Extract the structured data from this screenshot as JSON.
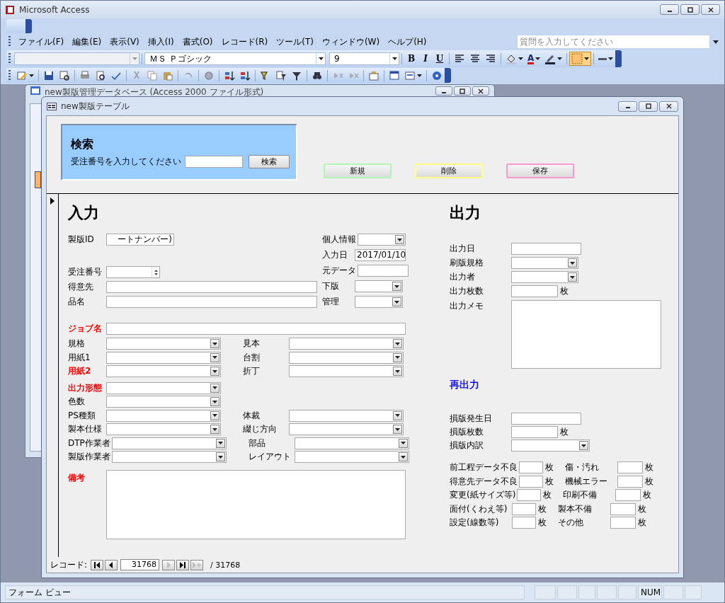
{
  "app_window": {
    "title": "Microsoft Access"
  },
  "menu": [
    "ファイル(F)",
    "編集(E)",
    "表示(V)",
    "挿入(I)",
    "書式(O)",
    "レコード(R)",
    "ツール(T)",
    "ウィンドウ(W)",
    "ヘルプ(H)"
  ],
  "help_search": {
    "placeholder": "質問を入力してください"
  },
  "format_toolbar": {
    "font": "ＭＳ Ｐゴシック",
    "size": "9",
    "style_buttons": [
      "B",
      "I",
      "U"
    ],
    "font_color_glyph": "A"
  },
  "background_window": {
    "title": "new製版管理データベース (Access 2000 ファイル形式)"
  },
  "form_window": {
    "title": "new製版テーブル"
  },
  "search_panel": {
    "title": "検索",
    "prompt": "受注番号を入力してください",
    "button": "検索"
  },
  "action_buttons": [
    {
      "label": "新規",
      "color": "#b3f5b3"
    },
    {
      "label": "削除",
      "color": "#ffff80"
    },
    {
      "label": "保存",
      "color": "#ff99cc"
    }
  ],
  "input_section": {
    "title": "入力",
    "top_left": [
      {
        "label": "製版ID",
        "kind": "text",
        "value": "ートナンバー)"
      },
      {
        "label": "受注番号",
        "kind": "spin"
      },
      {
        "label": "得意先",
        "kind": "text"
      },
      {
        "label": "品名",
        "kind": "text"
      }
    ],
    "top_right": [
      {
        "label": "個人情報",
        "kind": "combo"
      },
      {
        "label": "入力日",
        "kind": "text",
        "value": "2017/01/10"
      },
      {
        "label": "元データ",
        "kind": "text"
      },
      {
        "label": "下版",
        "kind": "combo"
      },
      {
        "label": "管理",
        "kind": "combo"
      }
    ],
    "job": {
      "label": "ジョブ名",
      "emphasized": true
    },
    "combo_rows": [
      {
        "left": {
          "label": "規格",
          "emphasized": false
        },
        "right": {
          "label": "見本",
          "emphasized": false
        }
      },
      {
        "left": {
          "label": "用紙1",
          "emphasized": false
        },
        "right": {
          "label": "台割",
          "emphasized": false
        }
      },
      {
        "left": {
          "label": "用紙2",
          "emphasized": true
        },
        "right": {
          "label": "折丁",
          "emphasized": false
        }
      },
      {
        "left": {
          "label": "出力形態",
          "emphasized": true
        }
      },
      {
        "left": {
          "label": "色数",
          "emphasized": false
        }
      },
      {
        "left": {
          "label": "PS種類",
          "emphasized": false
        },
        "right": {
          "label": "体裁",
          "emphasized": false
        }
      },
      {
        "left": {
          "label": "製本仕様",
          "emphasized": false
        },
        "right": {
          "label": "綴じ方向",
          "emphasized": false
        }
      },
      {
        "left": {
          "label": "DTP作業者",
          "emphasized": false
        },
        "right": {
          "label": "部品",
          "emphasized": false
        }
      },
      {
        "left": {
          "label": "製版作業者",
          "emphasized": false
        },
        "right": {
          "label": "レイアウト",
          "emphasized": false
        }
      }
    ],
    "remarks": {
      "label": "備考",
      "emphasized": true
    }
  },
  "output_section": {
    "title": "出力",
    "fields": [
      {
        "label": "出力日",
        "kind": "text"
      },
      {
        "label": "刷版規格",
        "kind": "combo"
      },
      {
        "label": "出力者",
        "kind": "combo"
      },
      {
        "label": "出力枚数",
        "kind": "count",
        "unit": "枚"
      },
      {
        "label": "出力メモ",
        "kind": "memo"
      }
    ]
  },
  "reoutput_section": {
    "title": "再出力",
    "fields": [
      {
        "label": "損版発生日",
        "kind": "text"
      },
      {
        "label": "損版枚数",
        "kind": "count",
        "unit": "枚"
      },
      {
        "label": "損版内訳",
        "kind": "combo"
      }
    ],
    "defects_left": [
      {
        "label": "前工程データ不良",
        "unit": "枚"
      },
      {
        "label": "得意先データ不良",
        "unit": "枚"
      },
      {
        "label": "変更(紙サイズ等)",
        "unit": "枚"
      },
      {
        "label": "面付(くわえ等)",
        "unit": "枚"
      },
      {
        "label": "設定(線数等)",
        "unit": "枚"
      }
    ],
    "defects_right": [
      {
        "label": "傷・汚れ",
        "unit": "枚"
      },
      {
        "label": "機械エラー",
        "unit": "枚"
      },
      {
        "label": "印刷不備",
        "unit": "枚"
      },
      {
        "label": "製本不備",
        "unit": "枚"
      },
      {
        "label": "その他",
        "unit": "枚"
      }
    ]
  },
  "record_nav": {
    "label": "レコード:",
    "current": "31768",
    "total": "/ 31768"
  },
  "status_bar": {
    "mode": "フォーム ビュー",
    "indicator": "NUM"
  }
}
